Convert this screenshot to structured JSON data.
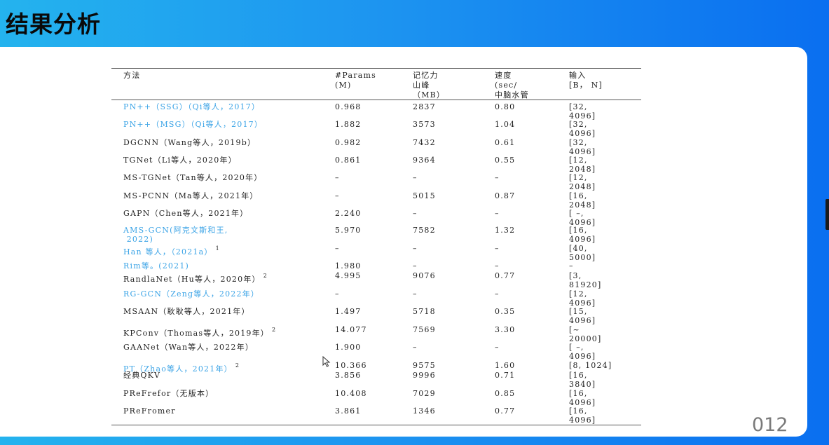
{
  "slide": {
    "title": "结果分析",
    "page_number": "012"
  },
  "table": {
    "headers": {
      "method": "方法",
      "params": "#Params\n(M)",
      "memory": "记忆力\n山峰\n（MB）",
      "speed": "速度\n(sec/\n中脑水管",
      "input": "输入\n[B， N]"
    },
    "rows": [
      {
        "method": "PN++（SSG）（Qi等人，2017）",
        "link": true,
        "note": "",
        "params": "0.968",
        "memory": "2837",
        "speed": "0.80",
        "input": "[32,\n4096]"
      },
      {
        "method": "PN++（MSG）（Qi等人，2017）",
        "link": true,
        "note": "",
        "params": "1.882",
        "memory": "3573",
        "speed": "1.04",
        "input": "[32,\n4096]"
      },
      {
        "method": "DGCNN（Wang等人，2019b）",
        "link": false,
        "note": "",
        "params": "0.982",
        "memory": "7432",
        "speed": "0.61",
        "input": "[32,\n4096]"
      },
      {
        "method": "TGNet（Li等人，2020年）",
        "link": false,
        "note": "",
        "params": "0.861",
        "memory": "9364",
        "speed": "0.55",
        "input": "[12,\n2048]"
      },
      {
        "method": "MS-TGNet（Tan等人，2020年）",
        "link": false,
        "note": "",
        "params": "–",
        "memory": "–",
        "speed": "–",
        "input": "[12,\n2048]"
      },
      {
        "method": "MS-PCNN（Ma等人，2021年）",
        "link": false,
        "note": "",
        "params": "–",
        "memory": "5015",
        "speed": "0.87",
        "input": "[16,\n2048]"
      },
      {
        "method": "GAPN（Chen等人，2021年）",
        "link": false,
        "note": "",
        "params": "2.240",
        "memory": "–",
        "speed": "–",
        "input": "[ –,\n4096]"
      },
      {
        "method": "AMS-GCN(阿克文斯和王,\n 2022)",
        "link": true,
        "note": "",
        "params": "5.970",
        "memory": "7582",
        "speed": "1.32",
        "input": "[16,\n4096]"
      },
      {
        "method": "Han 等人，（2021a）",
        "link": true,
        "note": "1",
        "params": "–",
        "memory": "–",
        "speed": "–",
        "input": "[40,\n5000]"
      },
      {
        "method": "Rim等。(2021)",
        "link": true,
        "note": "",
        "params": "1.980",
        "memory": "–",
        "speed": "–",
        "input": "–"
      },
      {
        "method": "RandlaNet（Hu等人，2020年）",
        "link": false,
        "note": "2",
        "params": "4.995",
        "memory": "9076",
        "speed": "0.77",
        "input": "[3,\n81920]"
      },
      {
        "method": "RG-GCN（Zeng等人，2022年）",
        "link": true,
        "note": "",
        "params": "–",
        "memory": "–",
        "speed": "–",
        "input": "[12,\n4096]"
      },
      {
        "method": "MSAAN（耿耿等人，2021年）",
        "link": false,
        "note": "",
        "params": "1.497",
        "memory": "5718",
        "speed": "0.35",
        "input": "[15,\n4096]"
      },
      {
        "method": "KPConv（Thomas等人，2019年）",
        "link": false,
        "note": "2",
        "params": "14.077",
        "memory": "7569",
        "speed": "3.30",
        "input": "[~\n20000]"
      },
      {
        "method": "GAANet（Wan等人，2022年）",
        "link": false,
        "note": "",
        "params": "1.900",
        "memory": "–",
        "speed": "–",
        "input": "[ –,\n4096]"
      },
      {
        "method": "PT（Zhao等人，2021年）",
        "link": true,
        "note": "2",
        "params": "10.366",
        "memory": "9575",
        "speed": "1.60",
        "input": "[8, 1024]"
      },
      {
        "method": "经典QKV",
        "link": false,
        "note": "",
        "params": "3.856",
        "memory": "9996",
        "speed": "0.71",
        "input": "[16,\n3840]"
      },
      {
        "method": "PReFrefor（无版本）",
        "link": false,
        "note": "",
        "params": "10.408",
        "memory": "7029",
        "speed": "0.85",
        "input": "[16,\n4096]"
      },
      {
        "method": "PReFromer",
        "link": false,
        "note": "",
        "params": "3.861",
        "memory": "1346",
        "speed": "0.77",
        "input": "[16,\n4096]"
      }
    ]
  },
  "colors": {
    "link": "#3aa3e6",
    "text": "#222222",
    "background_start": "#24b3ee",
    "background_end": "#0a6ff0"
  },
  "icons": {
    "cursor": "mouse-pointer-icon"
  }
}
